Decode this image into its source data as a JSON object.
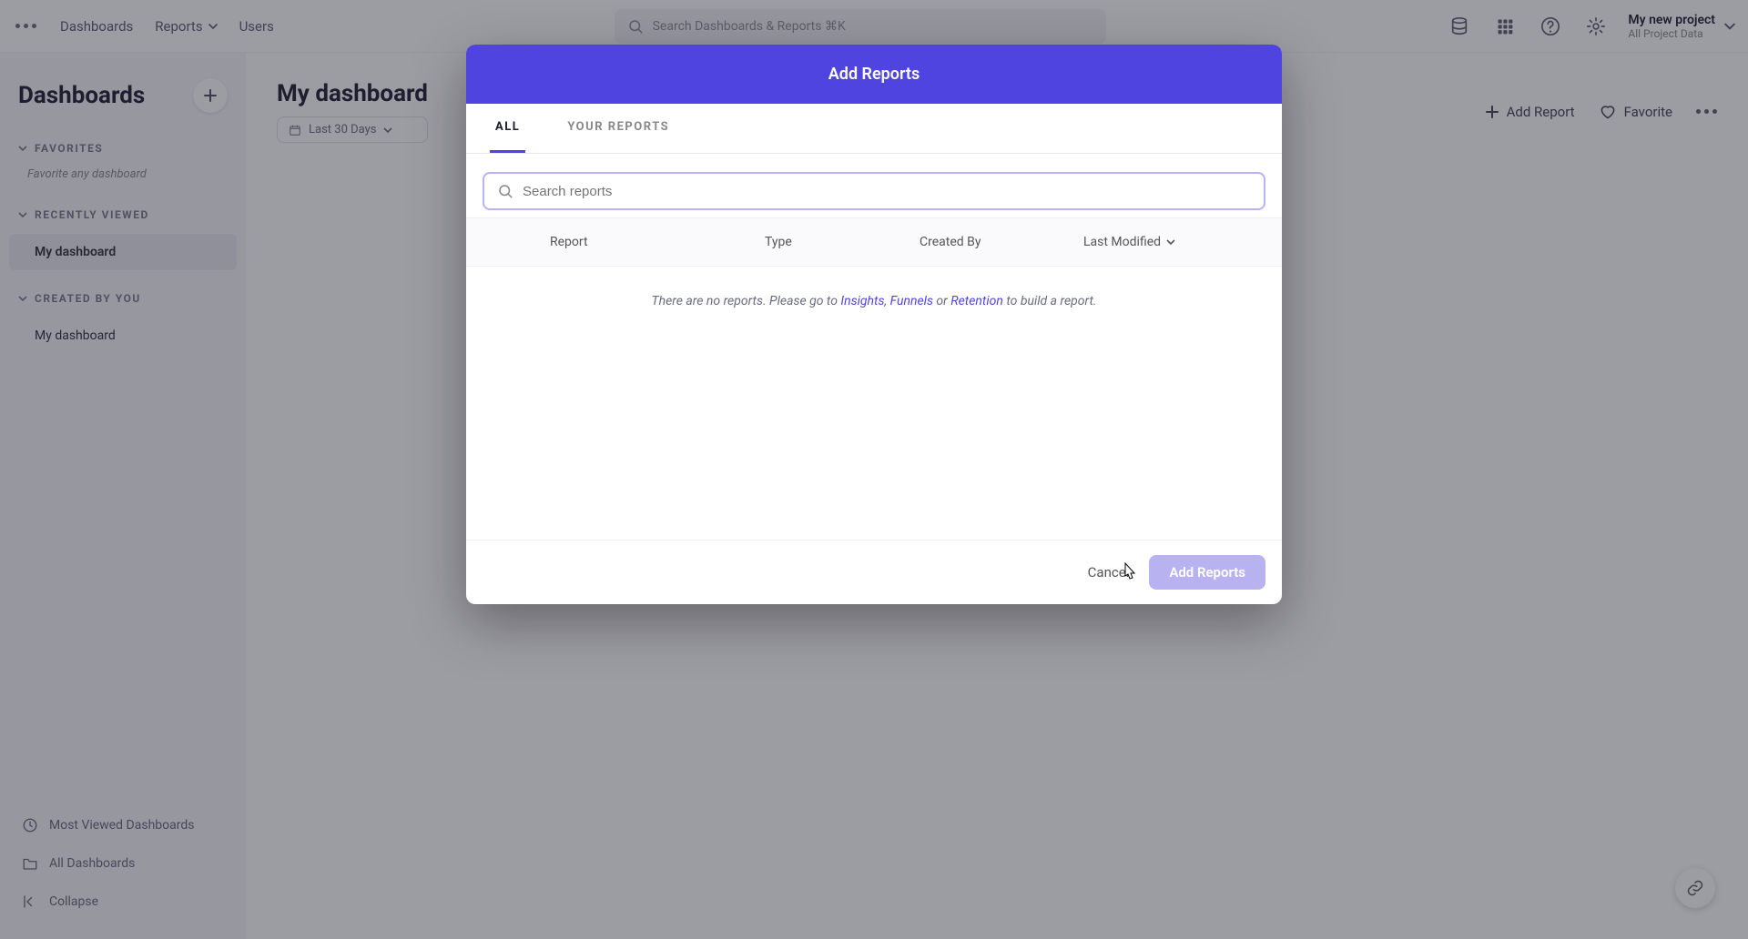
{
  "topnav": {
    "links": {
      "dashboards": "Dashboards",
      "reports": "Reports",
      "users": "Users"
    },
    "search_placeholder": "Search Dashboards & Reports ⌘K",
    "project": {
      "name": "My new project",
      "sub": "All Project Data"
    }
  },
  "sidebar": {
    "title": "Dashboards",
    "sections": {
      "favorites": "FAVORITES",
      "favorites_empty": "Favorite any dashboard",
      "recently": "RECENTLY VIEWED",
      "created": "CREATED BY YOU"
    },
    "items": {
      "recent0": "My dashboard",
      "created0": "My dashboard"
    },
    "bottom": {
      "most_viewed": "Most Viewed Dashboards",
      "all_dash": "All Dashboards",
      "collapse": "Collapse"
    }
  },
  "content": {
    "title": "My dashboard",
    "date_range": "Last 30 Days",
    "actions": {
      "add_report": "Add Report",
      "favorite": "Favorite"
    }
  },
  "modal": {
    "title": "Add Reports",
    "tabs": {
      "all": "ALL",
      "your": "YOUR REPORTS"
    },
    "search_placeholder": "Search reports",
    "columns": {
      "report": "Report",
      "type": "Type",
      "created": "Created By",
      "modified": "Last Modified"
    },
    "empty": {
      "prefix": "There are no reports. Please go to ",
      "link1": "Insights",
      "sep1": ", ",
      "link2": "Funnels",
      "sep2": " or ",
      "link3": "Retention",
      "suffix": " to build a report."
    },
    "footer": {
      "cancel": "Cancel",
      "submit": "Add Reports"
    }
  }
}
